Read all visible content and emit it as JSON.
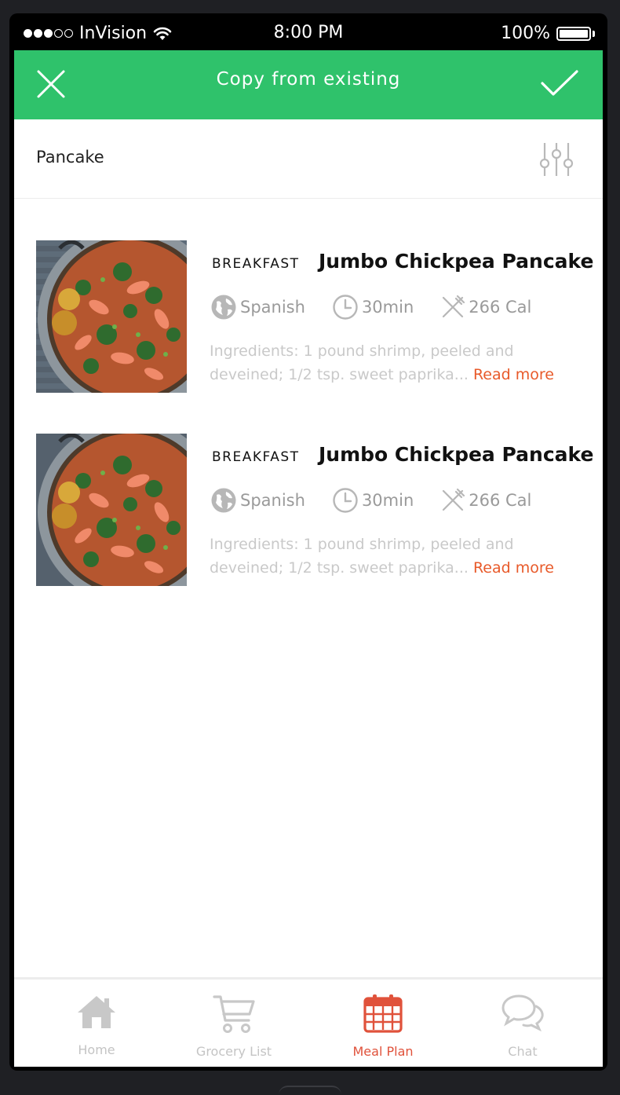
{
  "status_bar": {
    "carrier": "InVision",
    "time": "8:00 PM",
    "battery": "100%",
    "signal_bars_filled": 3,
    "signal_bars_total": 5
  },
  "header": {
    "title": "Copy from existing",
    "close_icon": "close-icon",
    "confirm_icon": "checkmark-icon",
    "color": "#2fc26b"
  },
  "search": {
    "query": "Pancake",
    "filter_icon": "sliders-icon"
  },
  "recipes": [
    {
      "meal_type": "BREAKFAST",
      "title": "Jumbo Chickpea Pancake",
      "cuisine": "Spanish",
      "time": "30min",
      "calories": "266 Cal",
      "ingredients": "Ingredients: 1 pound shrimp, peeled and deveined; 1/2 tsp. sweet paprika...",
      "read_more": "Read more"
    },
    {
      "meal_type": "BREAKFAST",
      "title": "Jumbo Chickpea Pancake",
      "cuisine": "Spanish",
      "time": "30min",
      "calories": "266 Cal",
      "ingredients": "Ingredients: 1 pound shrimp, peeled and deveined; 1/2 tsp. sweet paprika...",
      "read_more": "Read more"
    }
  ],
  "tabs": [
    {
      "label": "Home",
      "icon": "home-icon",
      "active": false
    },
    {
      "label": "Grocery List",
      "icon": "cart-icon",
      "active": false
    },
    {
      "label": "Meal Plan",
      "icon": "calendar-icon",
      "active": true
    },
    {
      "label": "Chat",
      "icon": "chat-icon",
      "active": false
    }
  ],
  "colors": {
    "accent_green": "#2fc26b",
    "accent_red": "#e0523b",
    "link_orange": "#e85a2a"
  }
}
